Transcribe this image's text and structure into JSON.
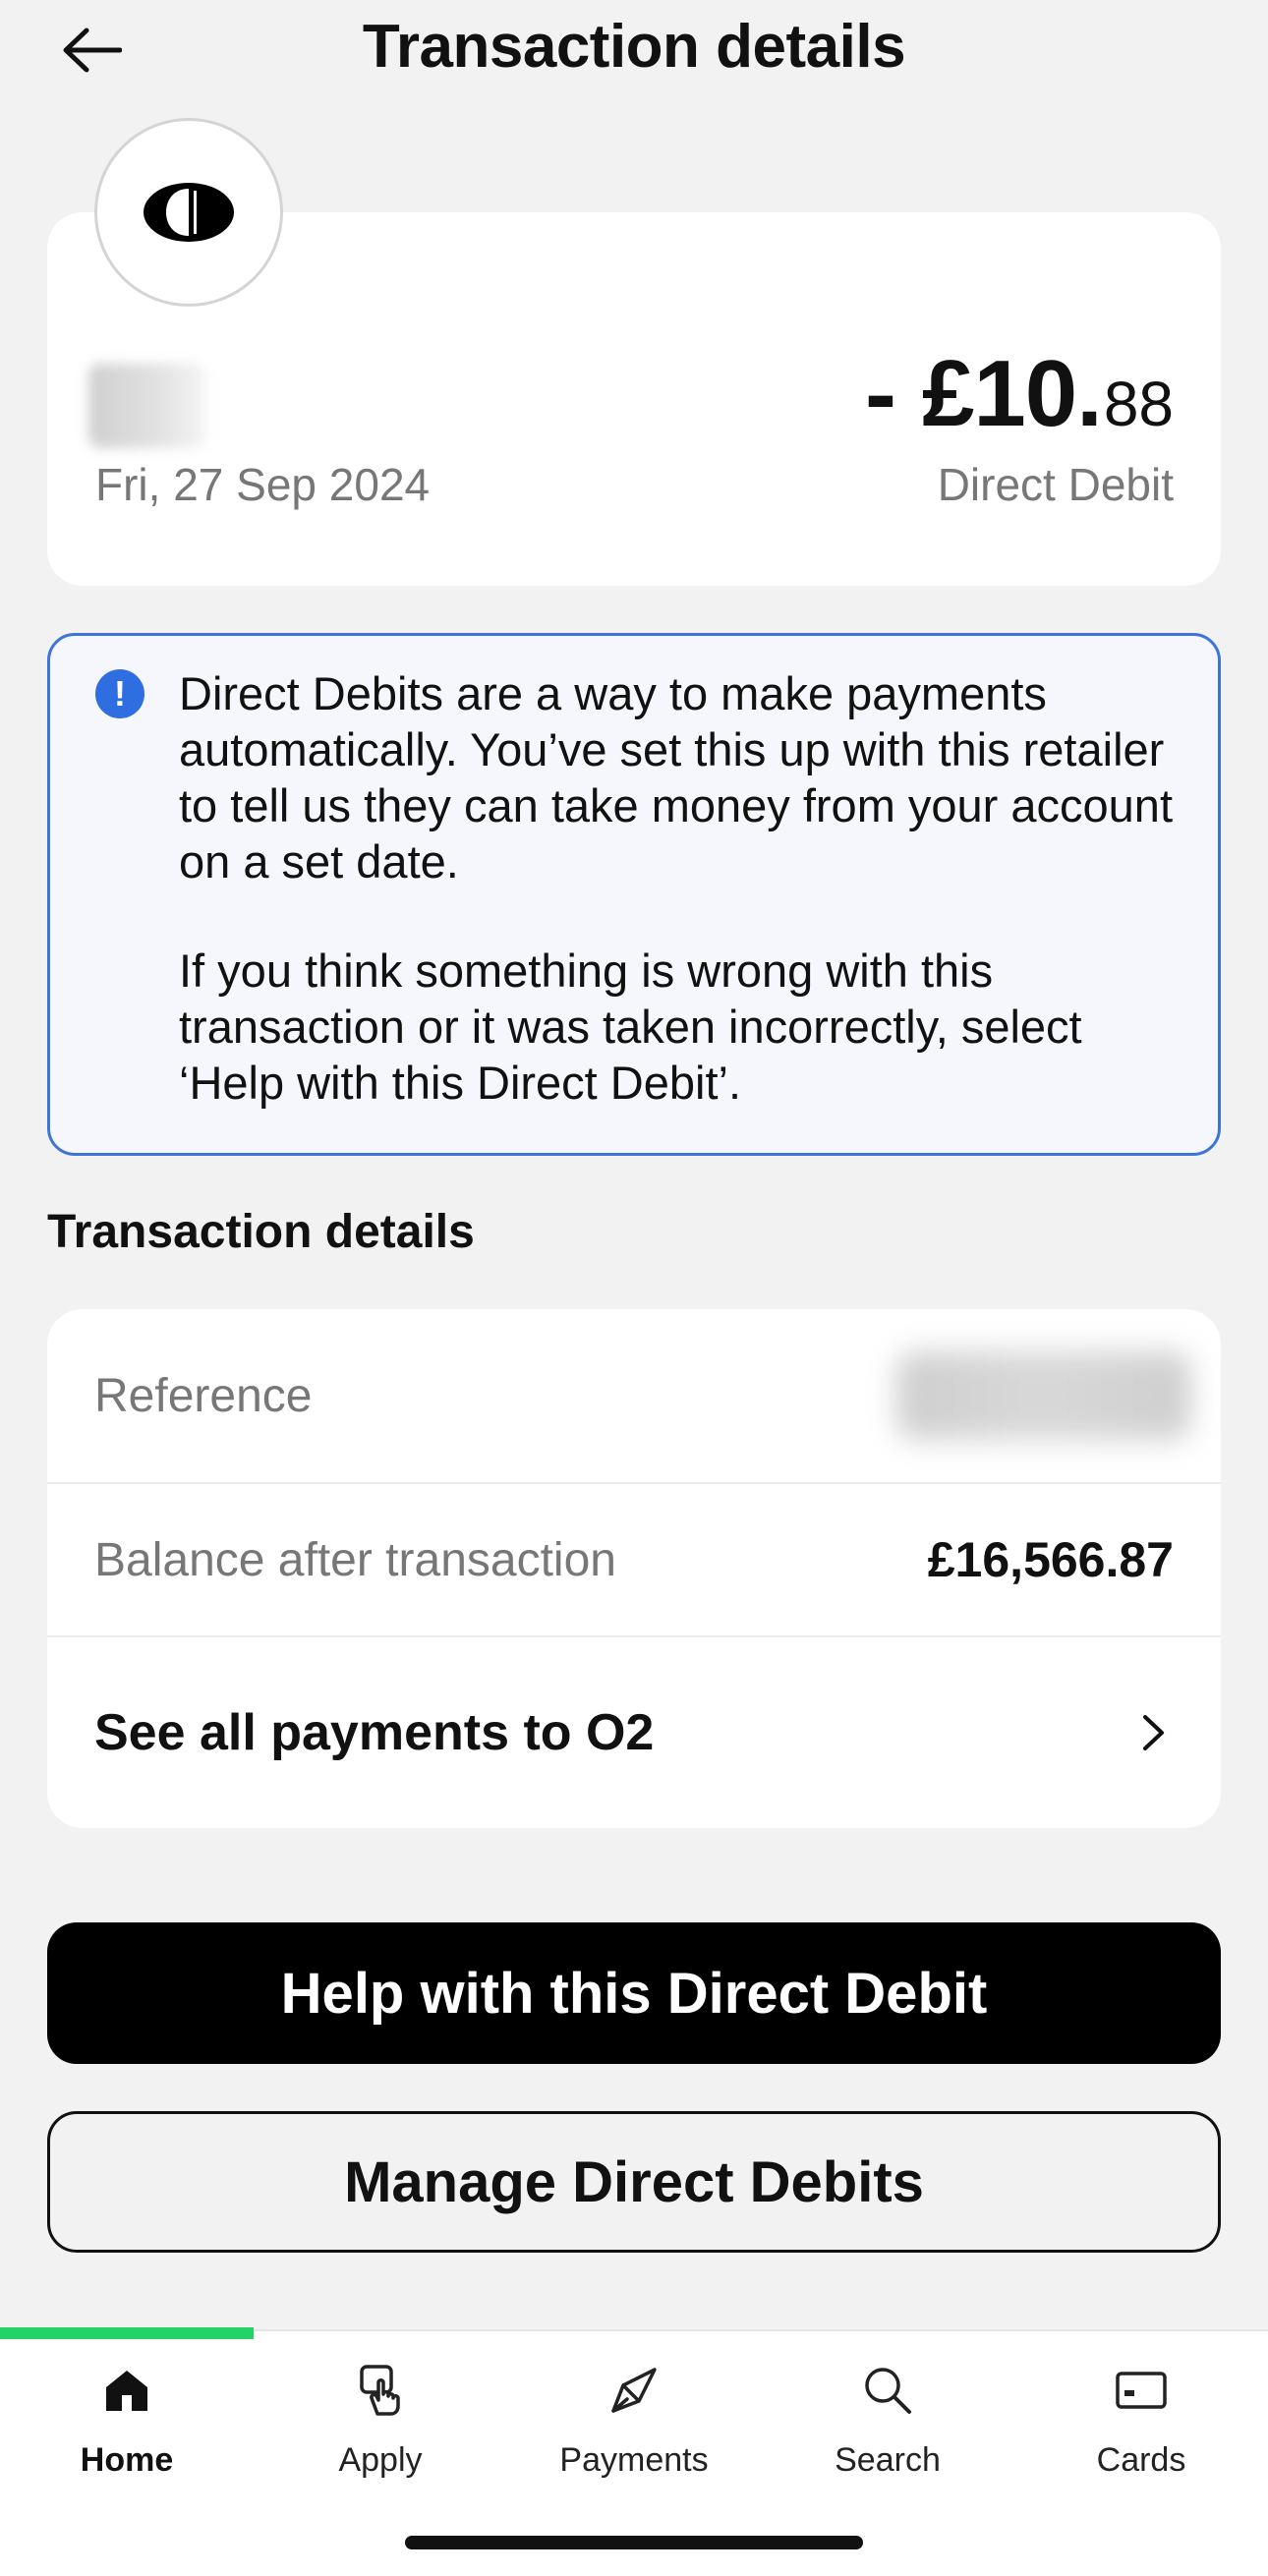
{
  "header": {
    "title": "Transaction details"
  },
  "transaction": {
    "date": "Fri, 27 Sep 2024",
    "amount_sign": "-",
    "amount_major": "£10.",
    "amount_minor": "88",
    "type": "Direct Debit"
  },
  "info": {
    "paragraph_1": "Direct Debits are a way to make payments automatically. You’ve set this up with this retailer to tell us they can take money from your account on a set date.",
    "paragraph_2": "If you think something is wrong with this transaction or it was taken incorrectly, select ‘Help with this Direct Debit’."
  },
  "details": {
    "section_title": "Transaction details",
    "reference_label": "Reference",
    "balance_label": "Balance after transaction",
    "balance_value": "£16,566.87",
    "see_all_label": "See all payments to O2"
  },
  "actions": {
    "help_label": "Help with this Direct Debit",
    "manage_label": "Manage Direct Debits"
  },
  "nav": {
    "items": [
      {
        "label": "Home",
        "icon": "home-icon",
        "active": true
      },
      {
        "label": "Apply",
        "icon": "apply-icon",
        "active": false
      },
      {
        "label": "Payments",
        "icon": "payments-icon",
        "active": false
      },
      {
        "label": "Search",
        "icon": "search-icon",
        "active": false
      },
      {
        "label": "Cards",
        "icon": "cards-icon",
        "active": false
      }
    ]
  },
  "colors": {
    "info_border": "#3d74d8",
    "info_icon": "#2f6ee0",
    "nav_active_indicator": "#23d366",
    "primary_button": "#000000"
  }
}
